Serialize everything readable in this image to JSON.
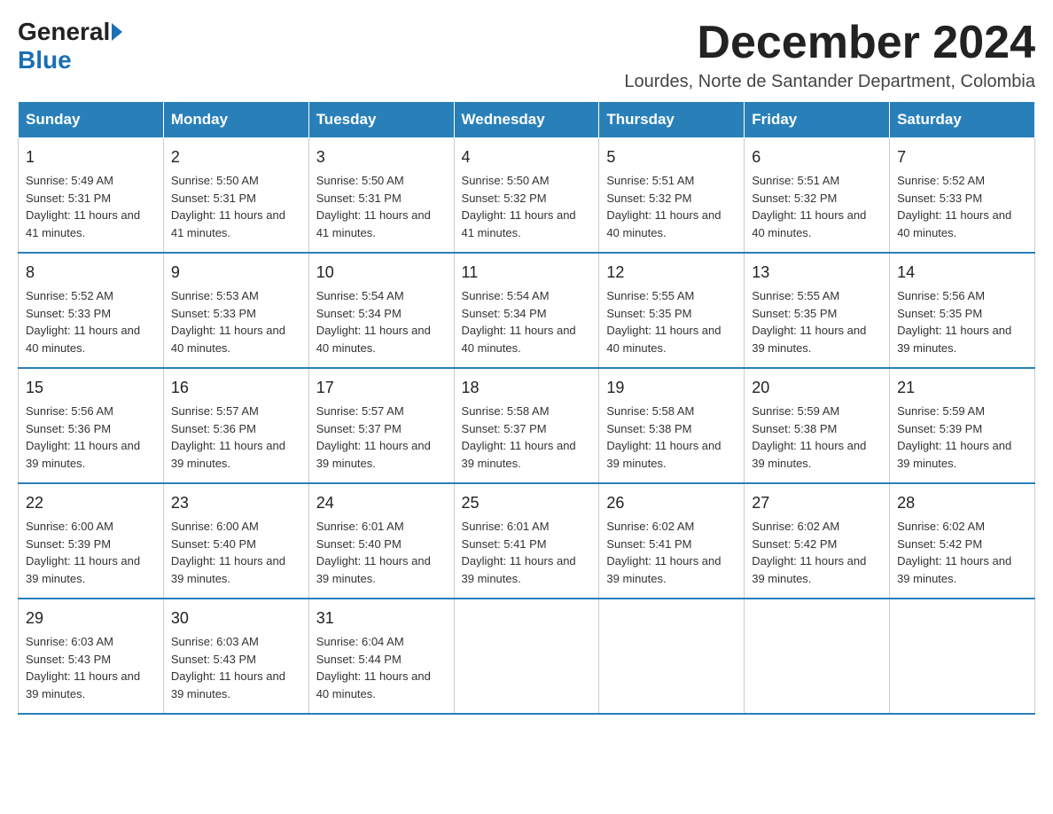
{
  "header": {
    "logo_general": "General",
    "logo_blue": "Blue",
    "month_title": "December 2024",
    "location": "Lourdes, Norte de Santander Department, Colombia"
  },
  "weekdays": [
    "Sunday",
    "Monday",
    "Tuesday",
    "Wednesday",
    "Thursday",
    "Friday",
    "Saturday"
  ],
  "weeks": [
    [
      {
        "day": "1",
        "sunrise": "Sunrise: 5:49 AM",
        "sunset": "Sunset: 5:31 PM",
        "daylight": "Daylight: 11 hours and 41 minutes."
      },
      {
        "day": "2",
        "sunrise": "Sunrise: 5:50 AM",
        "sunset": "Sunset: 5:31 PM",
        "daylight": "Daylight: 11 hours and 41 minutes."
      },
      {
        "day": "3",
        "sunrise": "Sunrise: 5:50 AM",
        "sunset": "Sunset: 5:31 PM",
        "daylight": "Daylight: 11 hours and 41 minutes."
      },
      {
        "day": "4",
        "sunrise": "Sunrise: 5:50 AM",
        "sunset": "Sunset: 5:32 PM",
        "daylight": "Daylight: 11 hours and 41 minutes."
      },
      {
        "day": "5",
        "sunrise": "Sunrise: 5:51 AM",
        "sunset": "Sunset: 5:32 PM",
        "daylight": "Daylight: 11 hours and 40 minutes."
      },
      {
        "day": "6",
        "sunrise": "Sunrise: 5:51 AM",
        "sunset": "Sunset: 5:32 PM",
        "daylight": "Daylight: 11 hours and 40 minutes."
      },
      {
        "day": "7",
        "sunrise": "Sunrise: 5:52 AM",
        "sunset": "Sunset: 5:33 PM",
        "daylight": "Daylight: 11 hours and 40 minutes."
      }
    ],
    [
      {
        "day": "8",
        "sunrise": "Sunrise: 5:52 AM",
        "sunset": "Sunset: 5:33 PM",
        "daylight": "Daylight: 11 hours and 40 minutes."
      },
      {
        "day": "9",
        "sunrise": "Sunrise: 5:53 AM",
        "sunset": "Sunset: 5:33 PM",
        "daylight": "Daylight: 11 hours and 40 minutes."
      },
      {
        "day": "10",
        "sunrise": "Sunrise: 5:54 AM",
        "sunset": "Sunset: 5:34 PM",
        "daylight": "Daylight: 11 hours and 40 minutes."
      },
      {
        "day": "11",
        "sunrise": "Sunrise: 5:54 AM",
        "sunset": "Sunset: 5:34 PM",
        "daylight": "Daylight: 11 hours and 40 minutes."
      },
      {
        "day": "12",
        "sunrise": "Sunrise: 5:55 AM",
        "sunset": "Sunset: 5:35 PM",
        "daylight": "Daylight: 11 hours and 40 minutes."
      },
      {
        "day": "13",
        "sunrise": "Sunrise: 5:55 AM",
        "sunset": "Sunset: 5:35 PM",
        "daylight": "Daylight: 11 hours and 39 minutes."
      },
      {
        "day": "14",
        "sunrise": "Sunrise: 5:56 AM",
        "sunset": "Sunset: 5:35 PM",
        "daylight": "Daylight: 11 hours and 39 minutes."
      }
    ],
    [
      {
        "day": "15",
        "sunrise": "Sunrise: 5:56 AM",
        "sunset": "Sunset: 5:36 PM",
        "daylight": "Daylight: 11 hours and 39 minutes."
      },
      {
        "day": "16",
        "sunrise": "Sunrise: 5:57 AM",
        "sunset": "Sunset: 5:36 PM",
        "daylight": "Daylight: 11 hours and 39 minutes."
      },
      {
        "day": "17",
        "sunrise": "Sunrise: 5:57 AM",
        "sunset": "Sunset: 5:37 PM",
        "daylight": "Daylight: 11 hours and 39 minutes."
      },
      {
        "day": "18",
        "sunrise": "Sunrise: 5:58 AM",
        "sunset": "Sunset: 5:37 PM",
        "daylight": "Daylight: 11 hours and 39 minutes."
      },
      {
        "day": "19",
        "sunrise": "Sunrise: 5:58 AM",
        "sunset": "Sunset: 5:38 PM",
        "daylight": "Daylight: 11 hours and 39 minutes."
      },
      {
        "day": "20",
        "sunrise": "Sunrise: 5:59 AM",
        "sunset": "Sunset: 5:38 PM",
        "daylight": "Daylight: 11 hours and 39 minutes."
      },
      {
        "day": "21",
        "sunrise": "Sunrise: 5:59 AM",
        "sunset": "Sunset: 5:39 PM",
        "daylight": "Daylight: 11 hours and 39 minutes."
      }
    ],
    [
      {
        "day": "22",
        "sunrise": "Sunrise: 6:00 AM",
        "sunset": "Sunset: 5:39 PM",
        "daylight": "Daylight: 11 hours and 39 minutes."
      },
      {
        "day": "23",
        "sunrise": "Sunrise: 6:00 AM",
        "sunset": "Sunset: 5:40 PM",
        "daylight": "Daylight: 11 hours and 39 minutes."
      },
      {
        "day": "24",
        "sunrise": "Sunrise: 6:01 AM",
        "sunset": "Sunset: 5:40 PM",
        "daylight": "Daylight: 11 hours and 39 minutes."
      },
      {
        "day": "25",
        "sunrise": "Sunrise: 6:01 AM",
        "sunset": "Sunset: 5:41 PM",
        "daylight": "Daylight: 11 hours and 39 minutes."
      },
      {
        "day": "26",
        "sunrise": "Sunrise: 6:02 AM",
        "sunset": "Sunset: 5:41 PM",
        "daylight": "Daylight: 11 hours and 39 minutes."
      },
      {
        "day": "27",
        "sunrise": "Sunrise: 6:02 AM",
        "sunset": "Sunset: 5:42 PM",
        "daylight": "Daylight: 11 hours and 39 minutes."
      },
      {
        "day": "28",
        "sunrise": "Sunrise: 6:02 AM",
        "sunset": "Sunset: 5:42 PM",
        "daylight": "Daylight: 11 hours and 39 minutes."
      }
    ],
    [
      {
        "day": "29",
        "sunrise": "Sunrise: 6:03 AM",
        "sunset": "Sunset: 5:43 PM",
        "daylight": "Daylight: 11 hours and 39 minutes."
      },
      {
        "day": "30",
        "sunrise": "Sunrise: 6:03 AM",
        "sunset": "Sunset: 5:43 PM",
        "daylight": "Daylight: 11 hours and 39 minutes."
      },
      {
        "day": "31",
        "sunrise": "Sunrise: 6:04 AM",
        "sunset": "Sunset: 5:44 PM",
        "daylight": "Daylight: 11 hours and 40 minutes."
      },
      null,
      null,
      null,
      null
    ]
  ]
}
